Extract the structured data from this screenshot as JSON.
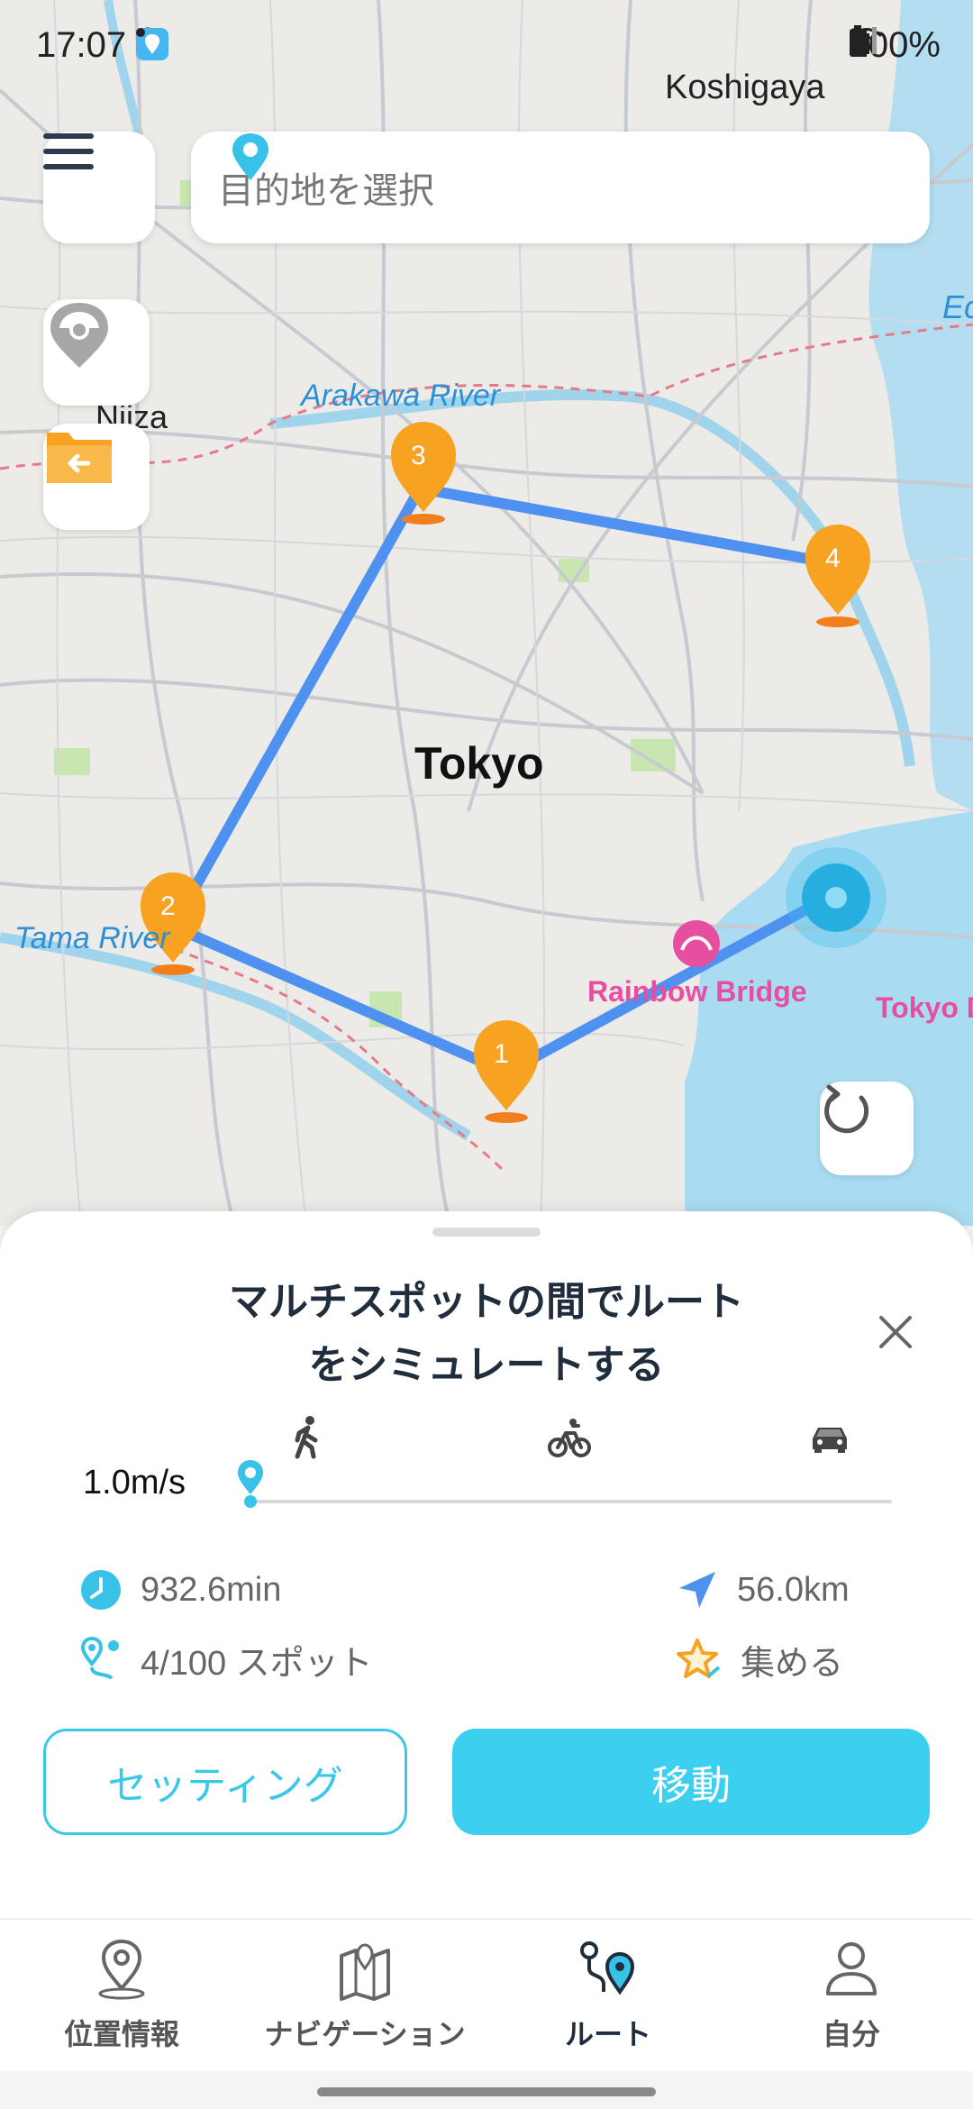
{
  "status_bar": {
    "time": "17:07",
    "battery": "100%",
    "icons": [
      "image-icon",
      "location-icon",
      "app-icon",
      "dot-icon",
      "mute-icon",
      "wifi-icon",
      "signal-icon",
      "battery-icon"
    ]
  },
  "map": {
    "labels": {
      "koshigaya": "Koshigaya",
      "niiza": "Niiza",
      "arakawa": "Arakawa River",
      "tokyo": "Tokyo",
      "tama": "Tama River",
      "rainbow": "Rainbow Bridge",
      "tokyo_d": "Tokyo D",
      "ec": "Ec"
    },
    "markers": [
      "1",
      "2",
      "3",
      "4"
    ],
    "route_color": "#4f91f0",
    "marker_color": "#f7a221"
  },
  "search": {
    "placeholder": "目的地を選択"
  },
  "sheet": {
    "title_line1": "マルチスポットの間でルート",
    "title_line2": "をシミュレートする",
    "speed": "1.0m/s",
    "speed_level": 0,
    "modes": [
      "walk-icon",
      "bike-icon",
      "car-icon"
    ],
    "stats": {
      "time": "932.6min",
      "distance": "56.0km",
      "spots": "4/100 スポット",
      "collect": "集める"
    },
    "settings_label": "セッティング",
    "move_label": "移動"
  },
  "tabs": [
    {
      "label": "位置情報",
      "icon": "location-pin-icon"
    },
    {
      "label": "ナビゲーション",
      "icon": "map-icon"
    },
    {
      "label": "ルート",
      "icon": "route-icon",
      "active": true
    },
    {
      "label": "自分",
      "icon": "person-icon"
    }
  ],
  "colors": {
    "accent": "#3ccff0",
    "text_dark": "#1f2d3d"
  }
}
